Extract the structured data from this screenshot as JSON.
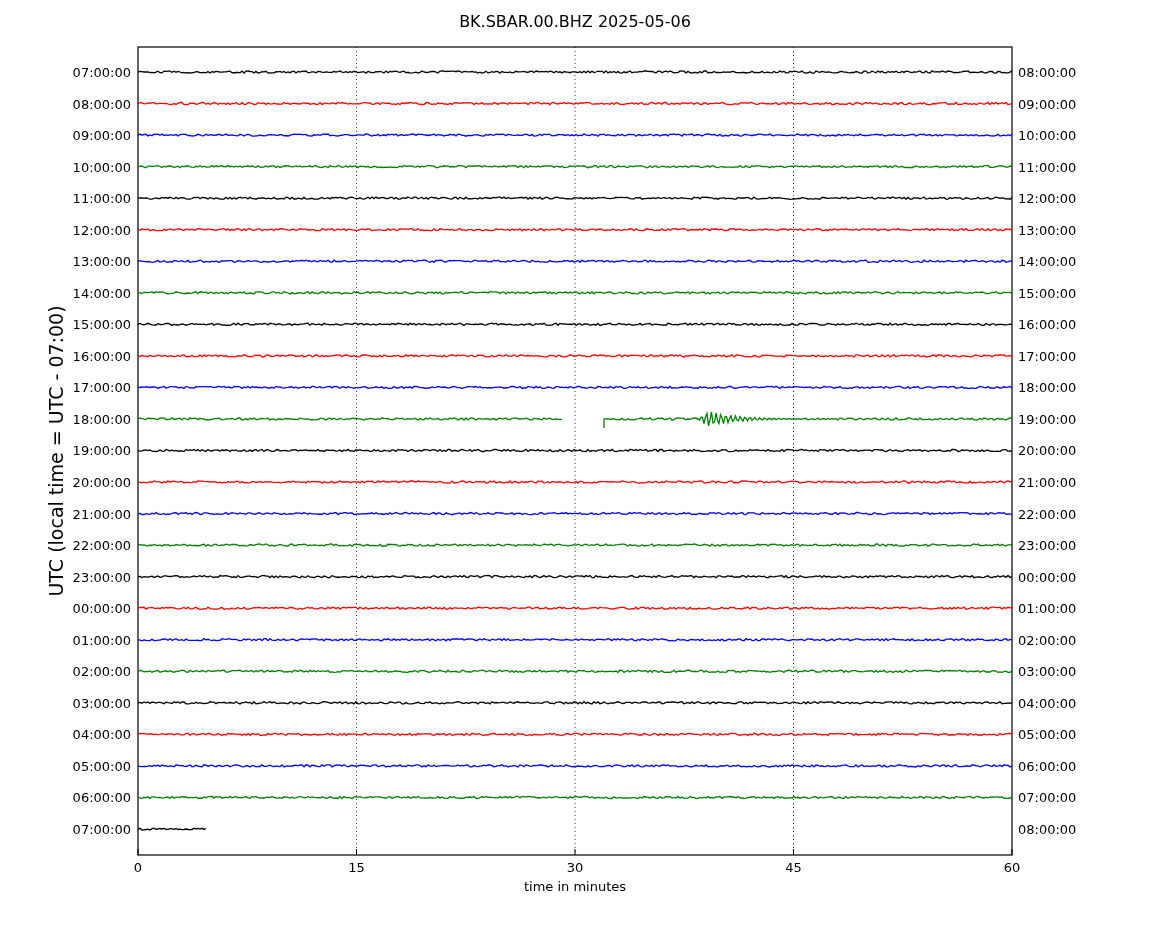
{
  "title": "BK.SBAR.00.BHZ 2025-05-06",
  "ylabel": "UTC (local time = UTC - 07:00)",
  "xlabel": "time in minutes",
  "xticks": [
    "0",
    "15",
    "30",
    "45",
    "60"
  ],
  "rows": [
    {
      "left": "07:00:00",
      "right": "08:00:00",
      "color": "#000000",
      "kind": "full"
    },
    {
      "left": "08:00:00",
      "right": "09:00:00",
      "color": "#ff0000",
      "kind": "full"
    },
    {
      "left": "09:00:00",
      "right": "10:00:00",
      "color": "#0000ff",
      "kind": "full"
    },
    {
      "left": "10:00:00",
      "right": "11:00:00",
      "color": "#008000",
      "kind": "full"
    },
    {
      "left": "11:00:00",
      "right": "12:00:00",
      "color": "#000000",
      "kind": "full"
    },
    {
      "left": "12:00:00",
      "right": "13:00:00",
      "color": "#ff0000",
      "kind": "full"
    },
    {
      "left": "13:00:00",
      "right": "14:00:00",
      "color": "#0000ff",
      "kind": "full"
    },
    {
      "left": "14:00:00",
      "right": "15:00:00",
      "color": "#008000",
      "kind": "full"
    },
    {
      "left": "15:00:00",
      "right": "16:00:00",
      "color": "#000000",
      "kind": "full"
    },
    {
      "left": "16:00:00",
      "right": "17:00:00",
      "color": "#ff0000",
      "kind": "full"
    },
    {
      "left": "17:00:00",
      "right": "18:00:00",
      "color": "#0000ff",
      "kind": "full"
    },
    {
      "left": "18:00:00",
      "right": "19:00:00",
      "color": "#008000",
      "kind": "event"
    },
    {
      "left": "19:00:00",
      "right": "20:00:00",
      "color": "#000000",
      "kind": "full"
    },
    {
      "left": "20:00:00",
      "right": "21:00:00",
      "color": "#ff0000",
      "kind": "full"
    },
    {
      "left": "21:00:00",
      "right": "22:00:00",
      "color": "#0000ff",
      "kind": "full"
    },
    {
      "left": "22:00:00",
      "right": "23:00:00",
      "color": "#008000",
      "kind": "full"
    },
    {
      "left": "23:00:00",
      "right": "00:00:00",
      "color": "#000000",
      "kind": "full"
    },
    {
      "left": "00:00:00",
      "right": "01:00:00",
      "color": "#ff0000",
      "kind": "full"
    },
    {
      "left": "01:00:00",
      "right": "02:00:00",
      "color": "#0000ff",
      "kind": "full"
    },
    {
      "left": "02:00:00",
      "right": "03:00:00",
      "color": "#008000",
      "kind": "full"
    },
    {
      "left": "03:00:00",
      "right": "04:00:00",
      "color": "#000000",
      "kind": "full"
    },
    {
      "left": "04:00:00",
      "right": "05:00:00",
      "color": "#ff0000",
      "kind": "full"
    },
    {
      "left": "05:00:00",
      "right": "06:00:00",
      "color": "#0000ff",
      "kind": "full"
    },
    {
      "left": "06:00:00",
      "right": "07:00:00",
      "color": "#008000",
      "kind": "full"
    },
    {
      "left": "07:00:00",
      "right": "08:00:00",
      "color": "#000000",
      "kind": "partial"
    }
  ]
}
